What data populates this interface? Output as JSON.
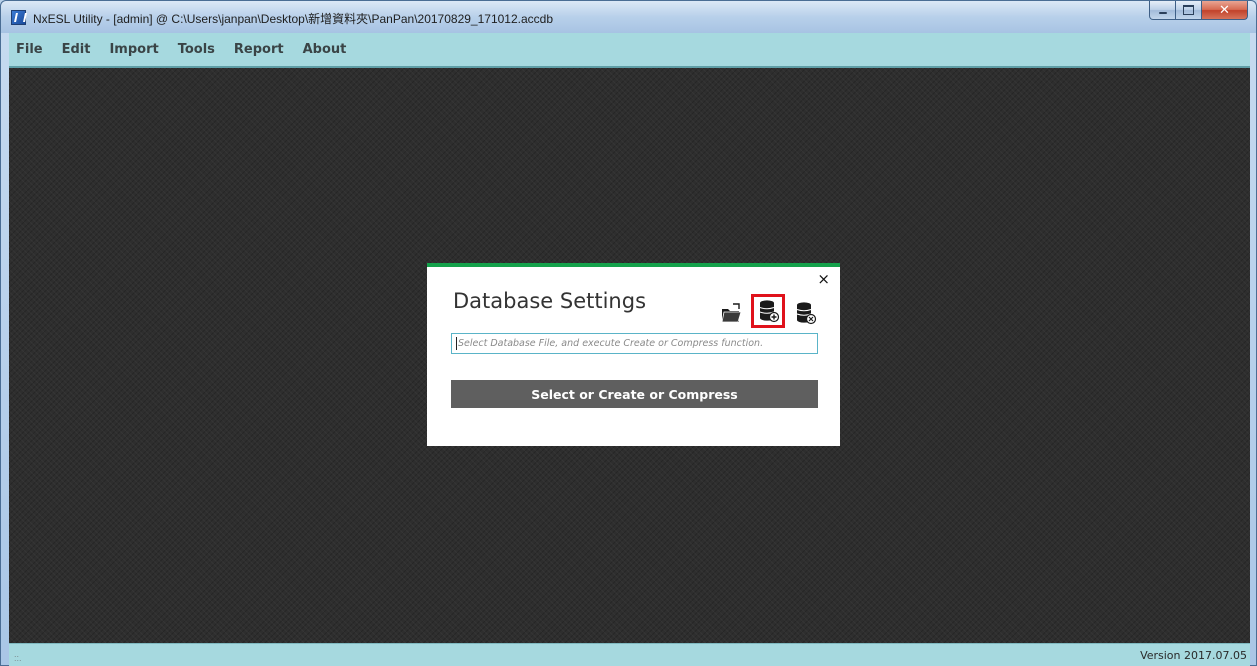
{
  "window": {
    "title": "NxESL Utility - [admin] @ C:\\Users\\janpan\\Desktop\\新增資料夾\\PanPan\\20170829_171012.accdb",
    "controls": {
      "minimize_icon": "minimize-icon",
      "maximize_icon": "maximize-icon",
      "close_glyph": "✕"
    }
  },
  "menu": {
    "items": [
      {
        "label": "File"
      },
      {
        "label": "Edit"
      },
      {
        "label": "Import"
      },
      {
        "label": "Tools"
      },
      {
        "label": "Report"
      },
      {
        "label": "About"
      }
    ]
  },
  "dialog": {
    "title": "Database Settings",
    "close_glyph": "×",
    "accent_color": "#14a14b",
    "highlight_color": "#e0121b",
    "icons": [
      "folder-open-icon",
      "database-create-icon",
      "database-compress-icon"
    ],
    "input": {
      "placeholder": "Select Database File, and execute Create or Compress function.",
      "value": ""
    },
    "action_label": "Select or Create or Compress"
  },
  "status": {
    "grip": "::.",
    "version": "Version 2017.07.05"
  }
}
